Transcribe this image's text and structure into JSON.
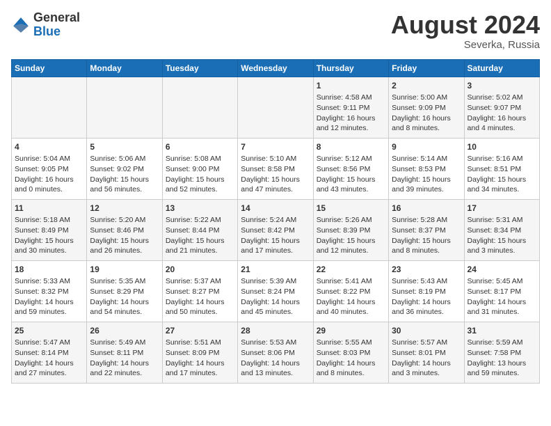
{
  "header": {
    "logo_line1": "General",
    "logo_line2": "Blue",
    "month_year": "August 2024",
    "location": "Severka, Russia"
  },
  "weekdays": [
    "Sunday",
    "Monday",
    "Tuesday",
    "Wednesday",
    "Thursday",
    "Friday",
    "Saturday"
  ],
  "weeks": [
    [
      {
        "day": "",
        "info": ""
      },
      {
        "day": "",
        "info": ""
      },
      {
        "day": "",
        "info": ""
      },
      {
        "day": "",
        "info": ""
      },
      {
        "day": "1",
        "info": "Sunrise: 4:58 AM\nSunset: 9:11 PM\nDaylight: 16 hours\nand 12 minutes."
      },
      {
        "day": "2",
        "info": "Sunrise: 5:00 AM\nSunset: 9:09 PM\nDaylight: 16 hours\nand 8 minutes."
      },
      {
        "day": "3",
        "info": "Sunrise: 5:02 AM\nSunset: 9:07 PM\nDaylight: 16 hours\nand 4 minutes."
      }
    ],
    [
      {
        "day": "4",
        "info": "Sunrise: 5:04 AM\nSunset: 9:05 PM\nDaylight: 16 hours\nand 0 minutes."
      },
      {
        "day": "5",
        "info": "Sunrise: 5:06 AM\nSunset: 9:02 PM\nDaylight: 15 hours\nand 56 minutes."
      },
      {
        "day": "6",
        "info": "Sunrise: 5:08 AM\nSunset: 9:00 PM\nDaylight: 15 hours\nand 52 minutes."
      },
      {
        "day": "7",
        "info": "Sunrise: 5:10 AM\nSunset: 8:58 PM\nDaylight: 15 hours\nand 47 minutes."
      },
      {
        "day": "8",
        "info": "Sunrise: 5:12 AM\nSunset: 8:56 PM\nDaylight: 15 hours\nand 43 minutes."
      },
      {
        "day": "9",
        "info": "Sunrise: 5:14 AM\nSunset: 8:53 PM\nDaylight: 15 hours\nand 39 minutes."
      },
      {
        "day": "10",
        "info": "Sunrise: 5:16 AM\nSunset: 8:51 PM\nDaylight: 15 hours\nand 34 minutes."
      }
    ],
    [
      {
        "day": "11",
        "info": "Sunrise: 5:18 AM\nSunset: 8:49 PM\nDaylight: 15 hours\nand 30 minutes."
      },
      {
        "day": "12",
        "info": "Sunrise: 5:20 AM\nSunset: 8:46 PM\nDaylight: 15 hours\nand 26 minutes."
      },
      {
        "day": "13",
        "info": "Sunrise: 5:22 AM\nSunset: 8:44 PM\nDaylight: 15 hours\nand 21 minutes."
      },
      {
        "day": "14",
        "info": "Sunrise: 5:24 AM\nSunset: 8:42 PM\nDaylight: 15 hours\nand 17 minutes."
      },
      {
        "day": "15",
        "info": "Sunrise: 5:26 AM\nSunset: 8:39 PM\nDaylight: 15 hours\nand 12 minutes."
      },
      {
        "day": "16",
        "info": "Sunrise: 5:28 AM\nSunset: 8:37 PM\nDaylight: 15 hours\nand 8 minutes."
      },
      {
        "day": "17",
        "info": "Sunrise: 5:31 AM\nSunset: 8:34 PM\nDaylight: 15 hours\nand 3 minutes."
      }
    ],
    [
      {
        "day": "18",
        "info": "Sunrise: 5:33 AM\nSunset: 8:32 PM\nDaylight: 14 hours\nand 59 minutes."
      },
      {
        "day": "19",
        "info": "Sunrise: 5:35 AM\nSunset: 8:29 PM\nDaylight: 14 hours\nand 54 minutes."
      },
      {
        "day": "20",
        "info": "Sunrise: 5:37 AM\nSunset: 8:27 PM\nDaylight: 14 hours\nand 50 minutes."
      },
      {
        "day": "21",
        "info": "Sunrise: 5:39 AM\nSunset: 8:24 PM\nDaylight: 14 hours\nand 45 minutes."
      },
      {
        "day": "22",
        "info": "Sunrise: 5:41 AM\nSunset: 8:22 PM\nDaylight: 14 hours\nand 40 minutes."
      },
      {
        "day": "23",
        "info": "Sunrise: 5:43 AM\nSunset: 8:19 PM\nDaylight: 14 hours\nand 36 minutes."
      },
      {
        "day": "24",
        "info": "Sunrise: 5:45 AM\nSunset: 8:17 PM\nDaylight: 14 hours\nand 31 minutes."
      }
    ],
    [
      {
        "day": "25",
        "info": "Sunrise: 5:47 AM\nSunset: 8:14 PM\nDaylight: 14 hours\nand 27 minutes."
      },
      {
        "day": "26",
        "info": "Sunrise: 5:49 AM\nSunset: 8:11 PM\nDaylight: 14 hours\nand 22 minutes."
      },
      {
        "day": "27",
        "info": "Sunrise: 5:51 AM\nSunset: 8:09 PM\nDaylight: 14 hours\nand 17 minutes."
      },
      {
        "day": "28",
        "info": "Sunrise: 5:53 AM\nSunset: 8:06 PM\nDaylight: 14 hours\nand 13 minutes."
      },
      {
        "day": "29",
        "info": "Sunrise: 5:55 AM\nSunset: 8:03 PM\nDaylight: 14 hours\nand 8 minutes."
      },
      {
        "day": "30",
        "info": "Sunrise: 5:57 AM\nSunset: 8:01 PM\nDaylight: 14 hours\nand 3 minutes."
      },
      {
        "day": "31",
        "info": "Sunrise: 5:59 AM\nSunset: 7:58 PM\nDaylight: 13 hours\nand 59 minutes."
      }
    ]
  ]
}
